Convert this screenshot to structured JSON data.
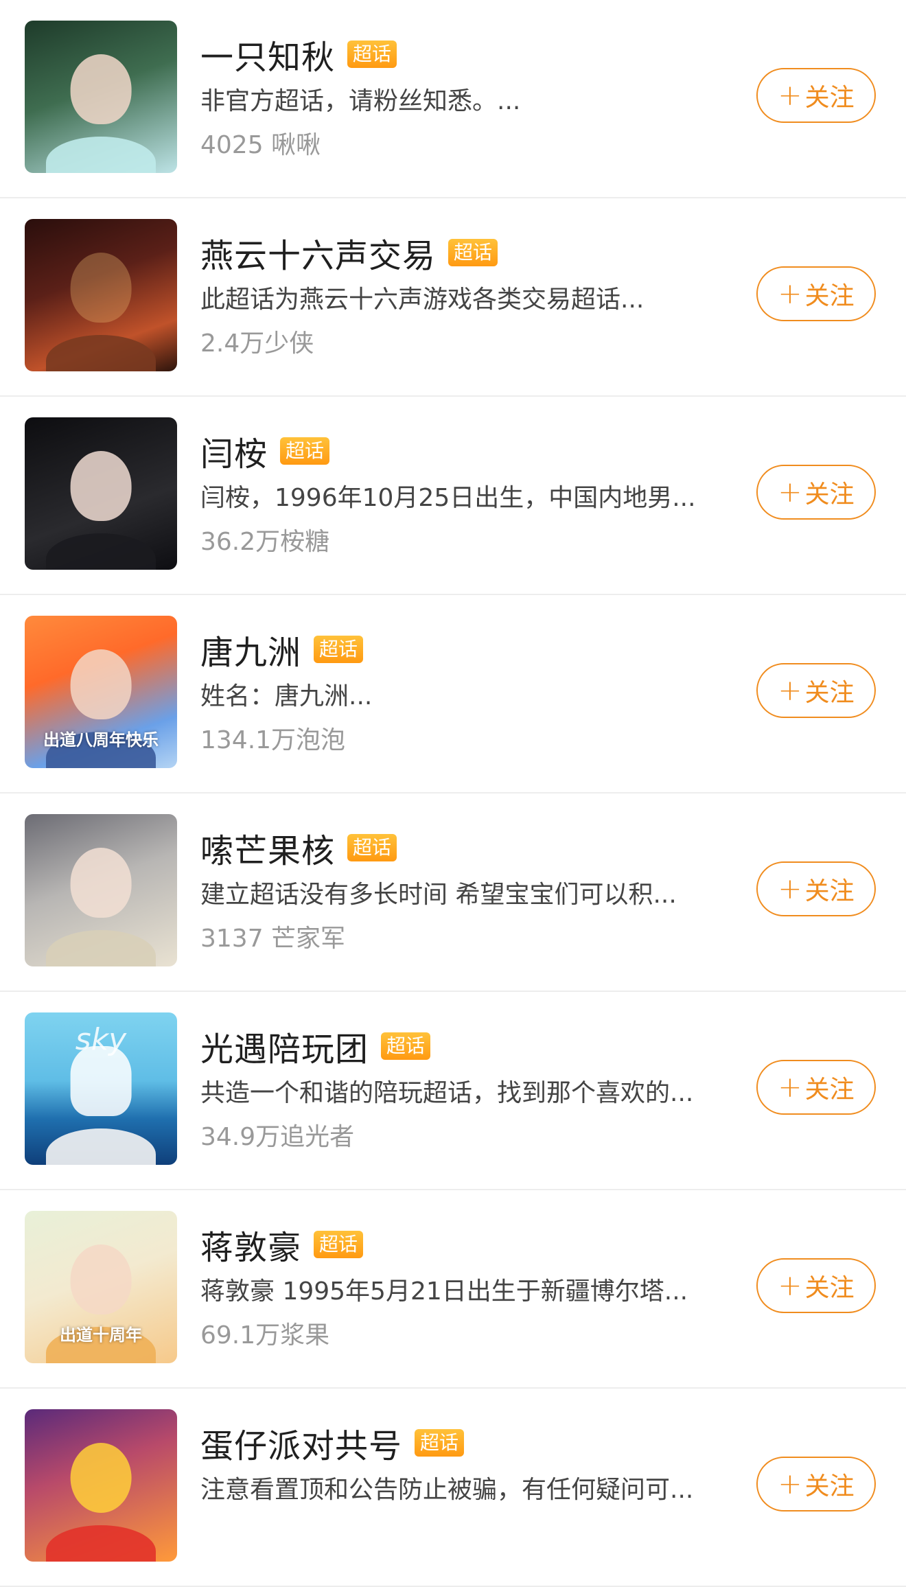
{
  "badge_label": "超话",
  "follow_label": "关注",
  "follow_icon": "plus-icon",
  "colors": {
    "accent": "#f08c1e",
    "badge": "#ffa41a",
    "title": "#1f1f1f",
    "desc": "#444444",
    "meta": "#999999",
    "divider": "#ededed"
  },
  "items": [
    {
      "title": "一只知秋",
      "desc": "非官方超话，请粉丝知悉。...",
      "meta": "4025 啾啾",
      "avatar_caption": "",
      "avatar_logo": ""
    },
    {
      "title": "燕云十六声交易",
      "desc": "此超话为燕云十六声游戏各类交易超话...",
      "meta": "2.4万少侠",
      "avatar_caption": "",
      "avatar_logo": ""
    },
    {
      "title": "闫桉",
      "desc": "闫桉，1996年10月25日出生，中国内地男...",
      "meta": "36.2万桉糖",
      "avatar_caption": "",
      "avatar_logo": ""
    },
    {
      "title": "唐九洲",
      "desc": "姓名：唐九洲...",
      "meta": "134.1万泡泡",
      "avatar_caption": "出道八周年快乐",
      "avatar_logo": ""
    },
    {
      "title": "嗦芒果核",
      "desc": "建立超话没有多长时间 希望宝宝们可以积...",
      "meta": "3137 芒家军",
      "avatar_caption": "",
      "avatar_logo": ""
    },
    {
      "title": "光遇陪玩团",
      "desc": "共造一个和谐的陪玩超话，找到那个喜欢的...",
      "meta": "34.9万追光者",
      "avatar_caption": "",
      "avatar_logo": "sky"
    },
    {
      "title": "蒋敦豪",
      "desc": "蒋敦豪 1995年5月21日出生于新疆博尔塔...",
      "meta": "69.1万浆果",
      "avatar_caption": "出道十周年",
      "avatar_logo": ""
    },
    {
      "title": "蛋仔派对共号",
      "desc": "注意看置顶和公告防止被骗，有任何疑问可...",
      "meta": "",
      "avatar_caption": "",
      "avatar_logo": ""
    }
  ]
}
